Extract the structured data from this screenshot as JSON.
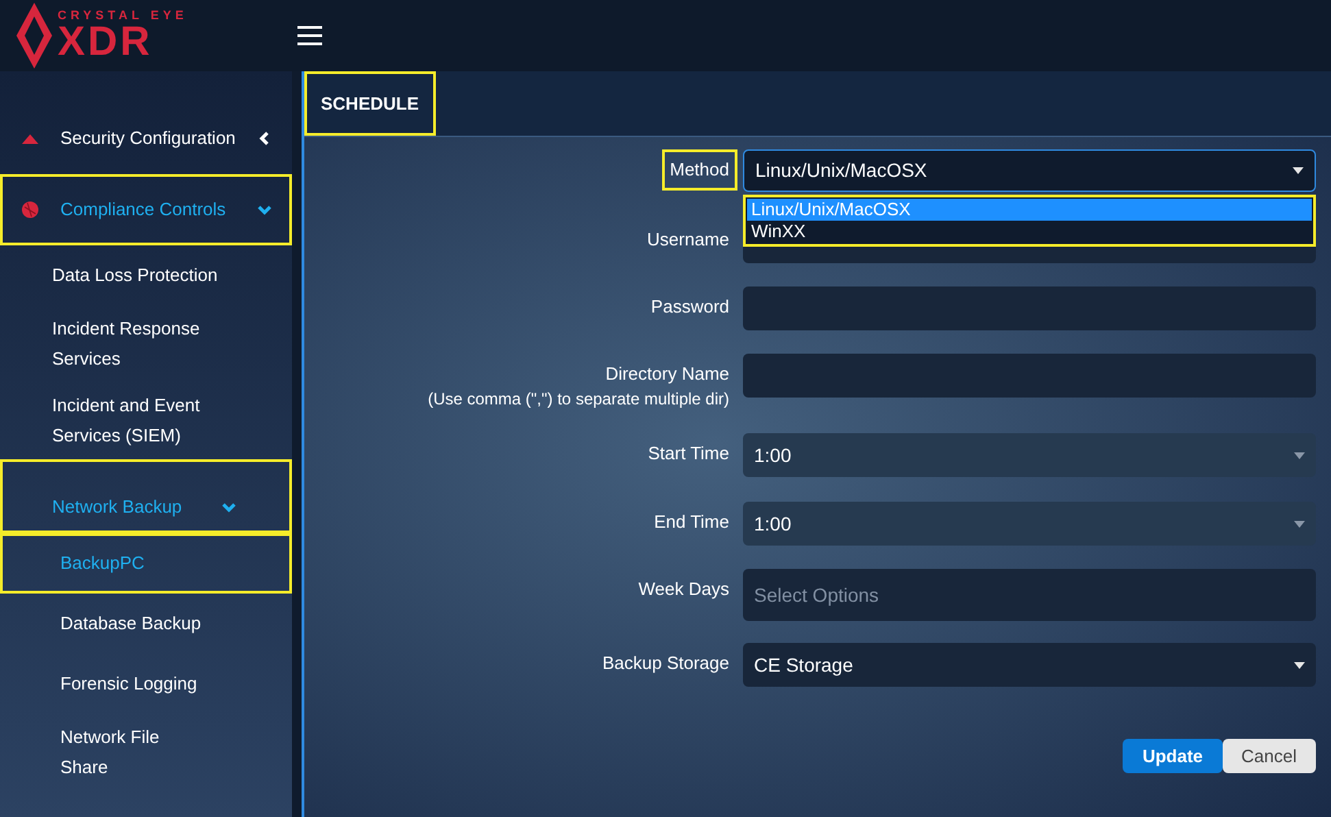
{
  "logo": {
    "brand": "CRYSTAL EYE",
    "product": "XDR"
  },
  "sidebar": {
    "items": [
      {
        "label": "Security Configuration",
        "kind": "triangle",
        "expanded": false,
        "selected": false,
        "highlighted": false
      },
      {
        "label": "Compliance Controls",
        "kind": "circle",
        "expanded": true,
        "selected": true,
        "highlighted": true,
        "children": [
          {
            "label": "Data Loss Protection",
            "selected": false,
            "highlighted": false
          },
          {
            "label": "Incident Response Services",
            "selected": false,
            "highlighted": false
          },
          {
            "label": "Incident and Event Services (SIEM)",
            "selected": false,
            "highlighted": false
          },
          {
            "label": "Network Backup",
            "selected": true,
            "expanded": true,
            "highlighted": true,
            "children": [
              {
                "label": "BackupPC",
                "selected": true,
                "highlighted": true
              },
              {
                "label": "Database Backup",
                "selected": false,
                "highlighted": false
              },
              {
                "label": "Forensic Logging",
                "selected": false,
                "highlighted": false
              },
              {
                "label": "Network File Share",
                "selected": false,
                "highlighted": false
              }
            ]
          }
        ]
      }
    ]
  },
  "tab": {
    "label": "SCHEDULE",
    "highlighted": true
  },
  "form": {
    "fields": [
      {
        "kind": "select",
        "label": "Method",
        "value": "Linux/Unix/MacOSX",
        "highlighted": true,
        "focused": true,
        "open": true,
        "options": [
          {
            "label": "Linux/Unix/MacOSX",
            "selected": true
          },
          {
            "label": "WinXX",
            "selected": false
          }
        ]
      },
      {
        "kind": "text",
        "label": "Username"
      },
      {
        "kind": "text",
        "label": "Password"
      },
      {
        "kind": "text",
        "label": "Directory Name",
        "hint": "(Use comma (\",\") to separate multiple dir)"
      },
      {
        "kind": "select",
        "label": "Start Time",
        "value": "1:00"
      },
      {
        "kind": "select",
        "label": "End Time",
        "value": "1:00"
      },
      {
        "kind": "multiselect",
        "label": "Week Days",
        "placeholder": "Select Options"
      },
      {
        "kind": "select",
        "label": "Backup Storage",
        "value": "CE Storage"
      }
    ]
  },
  "buttons": [
    {
      "label": "Update",
      "kind": "primary"
    },
    {
      "label": "Cancel",
      "kind": "secondary"
    }
  ]
}
